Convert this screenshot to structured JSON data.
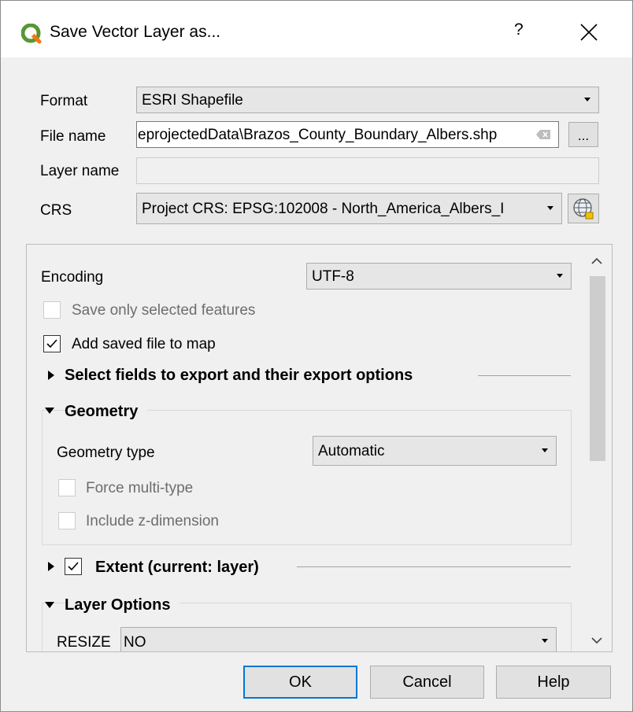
{
  "dialog": {
    "title": "Save Vector Layer as...",
    "help_label": "?",
    "close_label": "✕"
  },
  "form": {
    "format_label": "Format",
    "format_value": "ESRI Shapefile",
    "filename_label": "File name",
    "filename_value": "eprojectedData\\Brazos_County_Boundary_Albers.shp",
    "browse_label": "...",
    "layername_label": "Layer name",
    "layername_value": "",
    "crs_label": "CRS",
    "crs_value": "Project CRS: EPSG:102008 - North_America_Albers_I"
  },
  "options": {
    "encoding_label": "Encoding",
    "encoding_value": "UTF-8",
    "save_selected_label": "Save only selected features",
    "save_selected_checked": false,
    "add_to_map_label": "Add saved file to map",
    "add_to_map_checked": true,
    "select_fields_title": "Select fields to export and their export options",
    "geometry_title": "Geometry",
    "geometry_type_label": "Geometry type",
    "geometry_type_value": "Automatic",
    "force_multi_label": "Force multi-type",
    "include_z_label": "Include z-dimension",
    "extent_title": "Extent (current: layer)",
    "extent_checked": true,
    "layer_options_title": "Layer Options",
    "resize_label": "RESIZE",
    "resize_value": "NO"
  },
  "buttons": {
    "ok": "OK",
    "cancel": "Cancel",
    "help": "Help"
  },
  "colors": {
    "accent": "#0078d7",
    "qgis_green": "#589632"
  }
}
